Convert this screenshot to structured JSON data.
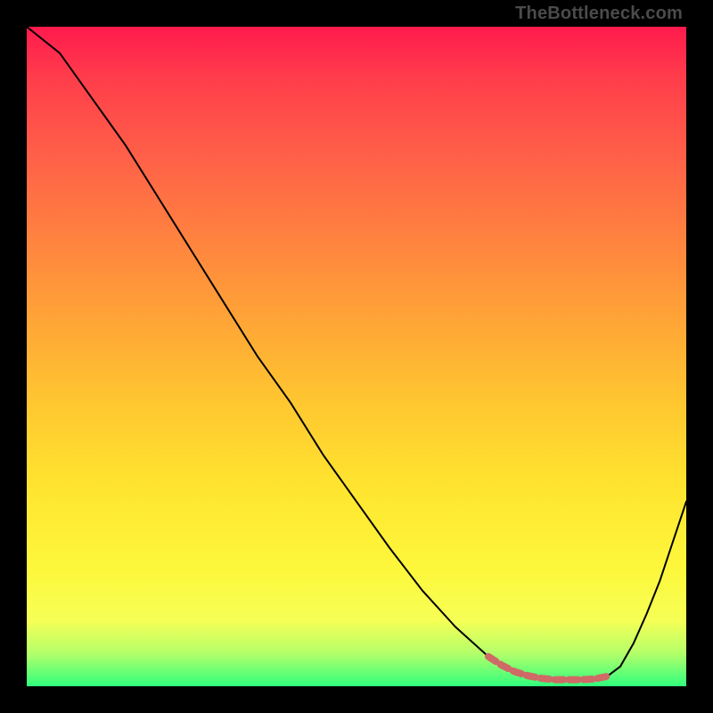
{
  "watermark": "TheBottleneck.com",
  "chart_data": {
    "type": "line",
    "title": "",
    "xlabel": "",
    "ylabel": "",
    "xlim": [
      0,
      100
    ],
    "ylim": [
      0,
      100
    ],
    "series": [
      {
        "name": "bottleneck-curve",
        "x": [
          0,
          5,
          10,
          15,
          20,
          25,
          30,
          35,
          40,
          45,
          50,
          55,
          60,
          65,
          70,
          72,
          74,
          76,
          78,
          80,
          82,
          84,
          86,
          88,
          90,
          92,
          94,
          96,
          98,
          100
        ],
        "y": [
          100,
          96,
          89,
          82,
          74,
          66,
          58,
          50,
          43,
          35,
          28,
          21,
          14.5,
          9,
          4.5,
          3.2,
          2.2,
          1.6,
          1.2,
          1.0,
          1.0,
          1.0,
          1.1,
          1.5,
          3.0,
          6.5,
          11,
          16,
          22,
          28
        ]
      },
      {
        "name": "optimal-band",
        "x": [
          70,
          72,
          74,
          76,
          78,
          80,
          82,
          84,
          86,
          88
        ],
        "y": [
          4.5,
          3.2,
          2.2,
          1.6,
          1.2,
          1.0,
          1.0,
          1.0,
          1.1,
          1.5
        ]
      }
    ],
    "annotations": []
  },
  "colors": {
    "curve": "#000000",
    "band": "#cf6a66",
    "frame": "#000000"
  }
}
